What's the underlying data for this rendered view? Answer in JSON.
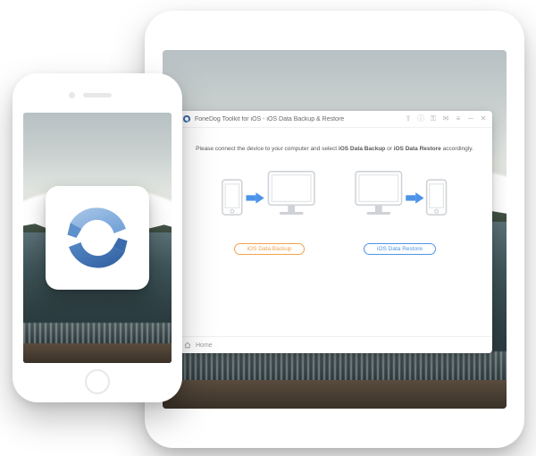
{
  "app_tile": {
    "icon_name": "sync-logo"
  },
  "window": {
    "title": "FoneDog Toolkit for iOS - iOS Data Backup & Restore",
    "instruction_prefix": "Please connect the device to your computer and select ",
    "instruction_strong1": "iOS Data Backup",
    "instruction_mid": " or ",
    "instruction_strong2": "iOS Data Restore",
    "instruction_suffix": " accordingly.",
    "options": {
      "backup": {
        "label": "iOS Data Backup"
      },
      "restore": {
        "label": "iOS Data Restore"
      }
    },
    "footer": {
      "home_label": "Home"
    },
    "colors": {
      "backup_accent": "#f0a24d",
      "restore_accent": "#4d94e8"
    }
  }
}
